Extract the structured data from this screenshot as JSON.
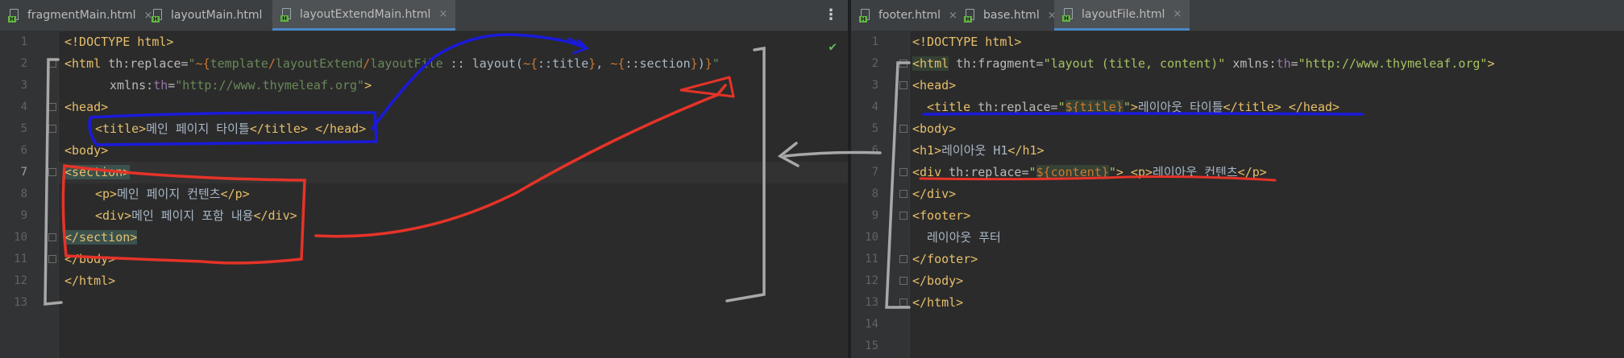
{
  "left": {
    "tabs": [
      {
        "label": "fragmentMain.html",
        "active": false
      },
      {
        "label": "layoutMain.html",
        "active": false
      },
      {
        "label": "layoutExtendMain.html",
        "active": true
      }
    ],
    "line_numbers": [
      "1",
      "2",
      "3",
      "4",
      "5",
      "6",
      "7",
      "8",
      "9",
      "10",
      "11",
      "12",
      "13"
    ],
    "code": {
      "l1_doctype": "<!DOCTYPE html>",
      "l2_open": "<html",
      "l2_attr": "th:replace=",
      "l2_q1": "\"",
      "l2_tpl_open": "~{",
      "l2_path_a": "template",
      "l2_slash1": "/",
      "l2_path_b": "layoutExtend",
      "l2_slash2": "/",
      "l2_path_c": "layoutFile",
      "l2_colons": " :: ",
      "l2_call": "layout(",
      "l2_frag1_open": "~{",
      "l2_frag1": "::title",
      "l2_frag1_close": "}",
      "l2_comma": ", ",
      "l2_frag2_open": "~{",
      "l2_frag2": "::section",
      "l2_frag2_close": "}",
      "l2_end": ")",
      "l2_tpl_close": "}",
      "l2_q2": "\"",
      "l3_ns": "xmlns:",
      "l3_th": "th",
      "l3_eq": "=",
      "l3_val": "\"http://www.thymeleaf.org\"",
      "l3_close": ">",
      "l4": "<head>",
      "l5_title_open": "<title>",
      "l5_title_text": "메인 페이지 타이틀",
      "l5_title_close": "</title>",
      "l5_head_close": " </head>",
      "l6": "<body>",
      "l7": "<section>",
      "l8_p_open": "<p>",
      "l8_text": "메인 페이지 컨텐츠",
      "l8_p_close": "</p>",
      "l9_div_open": "<div>",
      "l9_text": "메인 페이지 포함 내용",
      "l9_div_close": "</div>",
      "l10": "</section>",
      "l11": "</body>",
      "l12": "</html>"
    }
  },
  "right": {
    "tabs": [
      {
        "label": "footer.html",
        "active": false
      },
      {
        "label": "base.html",
        "active": false
      },
      {
        "label": "layoutFile.html",
        "active": true
      }
    ],
    "line_numbers": [
      "1",
      "2",
      "3",
      "4",
      "5",
      "6",
      "7",
      "8",
      "9",
      "10",
      "11",
      "12",
      "13",
      "14",
      "15"
    ],
    "code": {
      "l1_doctype": "<!DOCTYPE html>",
      "l2_open": "<html",
      "l2_attr": " th:fragment=",
      "l2_val": "\"layout (title, content)\"",
      "l2_ns": " xmlns:",
      "l2_th": "th",
      "l2_eq": "=",
      "l2_url": "\"http://www.thymeleaf.org\"",
      "l2_close": ">",
      "l3": "<head>",
      "l4_open": "<title",
      "l4_attr": " th:replace=",
      "l4_q1": "\"",
      "l4_var": "${title}",
      "l4_q2": "\"",
      "l4_gt": ">",
      "l4_text": "레이아웃 타이틀",
      "l4_close": "</title>",
      "l4_head_close": " </head>",
      "l5": "<body>",
      "l6_open": "<h1>",
      "l6_text": "레이아웃 H1",
      "l6_close": "</h1>",
      "l7_open": "<div",
      "l7_attr": " th:replace=",
      "l7_q1": "\"",
      "l7_var": "${content}",
      "l7_q2": "\"",
      "l7_gt": ">",
      "l7_p_open": " <p>",
      "l7_text": "레이아웃 컨텐츠",
      "l7_p_close": "</p>",
      "l8": "</div>",
      "l9": "<footer>",
      "l10_text": "레이아웃 푸터",
      "l11": "</footer>",
      "l12": "</body>",
      "l13": "</html>"
    }
  },
  "icons": {
    "menu": "kebab-menu-icon",
    "check": "checkmark-icon",
    "close": "×",
    "kebab_glyph": "⋮",
    "check_glyph": "✔"
  },
  "colors": {
    "editor_bg": "#2b2b2b",
    "tag": "#e8bf6a",
    "string": "#6a8759",
    "annotation_blue": "#1a1adb",
    "annotation_red": "#e63328",
    "annotation_gray": "#9a9a9a"
  }
}
